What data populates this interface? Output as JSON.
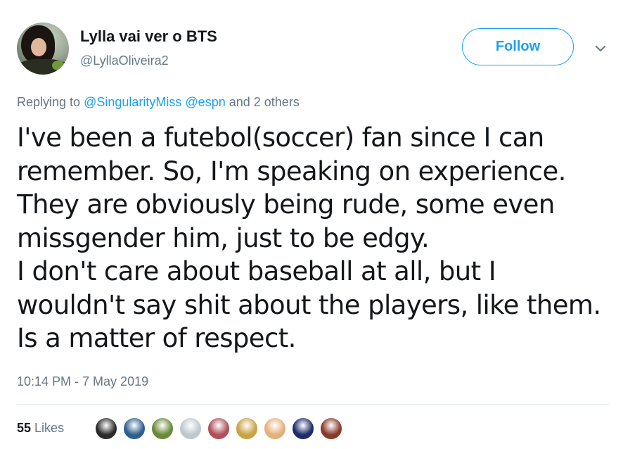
{
  "author": {
    "display_name": "Lylla vai ver o BTS",
    "handle": "@LyllaOliveira2"
  },
  "follow_button": {
    "label": "Follow"
  },
  "menu": {
    "icon": "chevron-down-icon"
  },
  "reply_context": {
    "prefix": "Replying to",
    "mentions": [
      "@SingularityMiss",
      "@espn"
    ],
    "suffix": "and 2 others"
  },
  "tweet": {
    "lines": [
      "I've been a futebol(soccer) fan since I can",
      "remember. So, I'm speaking on experience.",
      "They are obviously being rude, some even",
      "missgender him, just to be edgy.",
      "I don't care about baseball at all, but I",
      "wouldn't say shit about the players, like them.",
      "Is a matter of respect."
    ],
    "timestamp": "10:14 PM - 7 May 2019"
  },
  "engagement": {
    "likes_count": "55",
    "likes_label": "Likes"
  },
  "colors": {
    "accent": "#1da1f2",
    "muted_text": "#657786",
    "primary_text": "#14171a"
  },
  "likers": [
    {
      "name": "liker-avatar-1",
      "bg": "#2b2b2b"
    },
    {
      "name": "liker-avatar-2",
      "bg": "#2f5f8f"
    },
    {
      "name": "liker-avatar-3",
      "bg": "#6a8a3a"
    },
    {
      "name": "liker-avatar-4",
      "bg": "#c0c7cd"
    },
    {
      "name": "liker-avatar-5",
      "bg": "#b0505a"
    },
    {
      "name": "liker-avatar-6",
      "bg": "#c9a246"
    },
    {
      "name": "liker-avatar-7",
      "bg": "#e3b07a"
    },
    {
      "name": "liker-avatar-8",
      "bg": "#1d2c6a"
    },
    {
      "name": "liker-avatar-9",
      "bg": "#8a3a2a"
    }
  ]
}
